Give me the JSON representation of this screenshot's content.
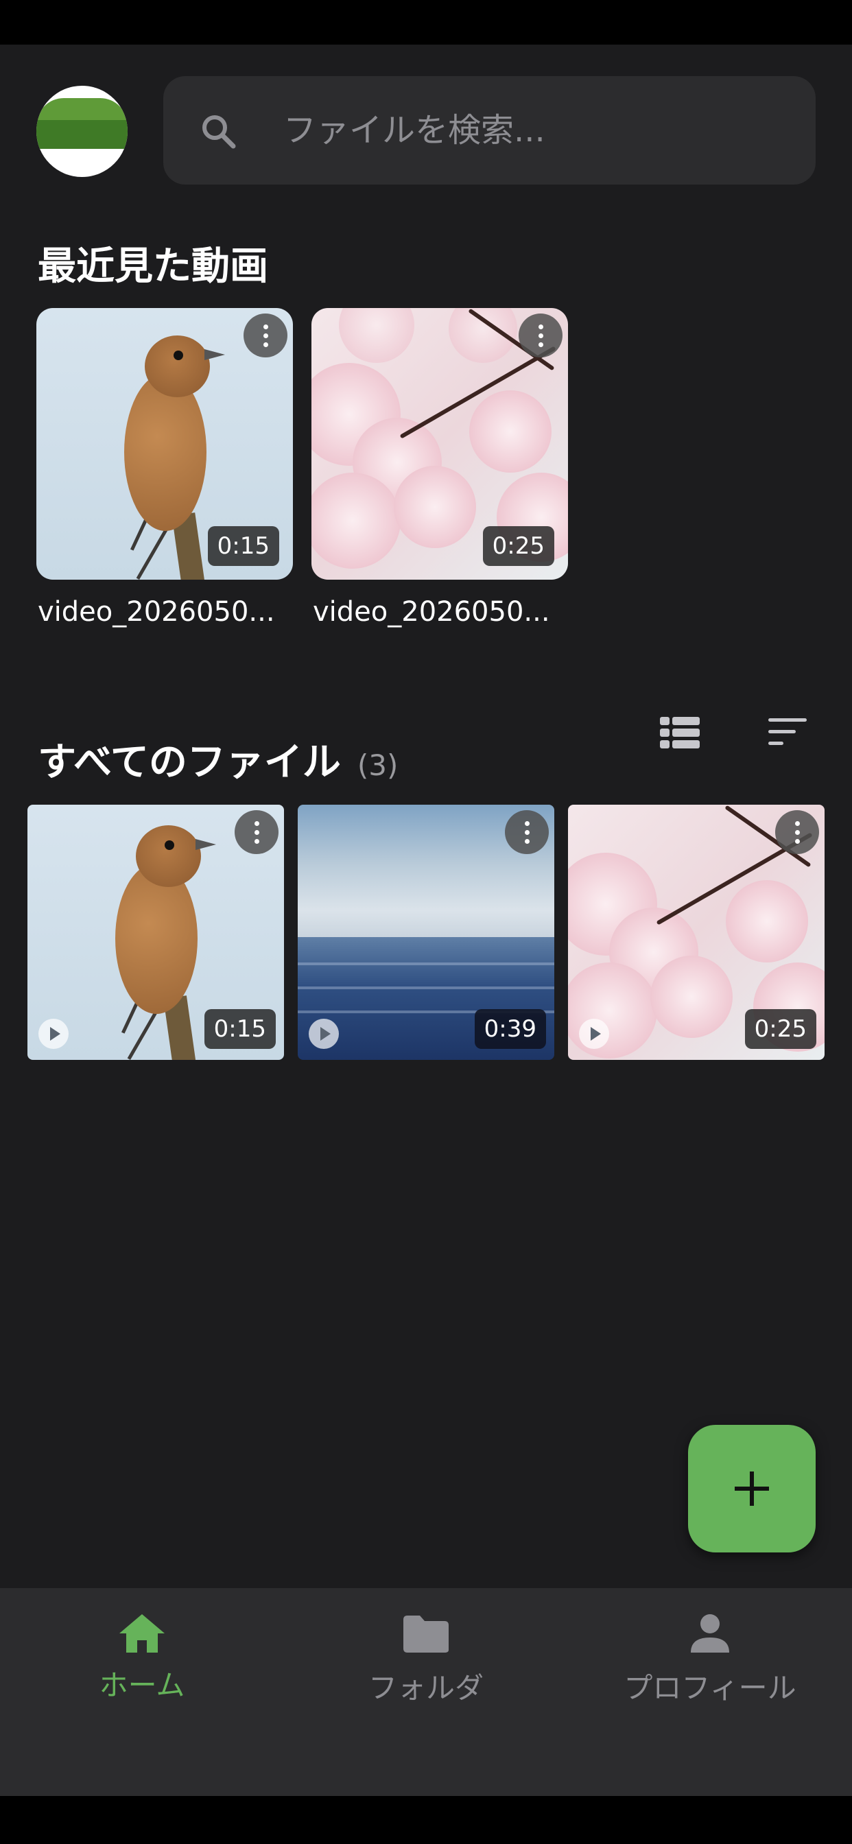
{
  "search": {
    "placeholder": "ファイルを検索..."
  },
  "recent": {
    "title": "最近見た動画",
    "items": [
      {
        "name": "video_2026050...",
        "duration": "0:15",
        "thumbnail": "bird"
      },
      {
        "name": "video_2026050...",
        "duration": "0:25",
        "thumbnail": "cherry-blossom"
      }
    ]
  },
  "all_files": {
    "title": "すべてのファイル",
    "count": "(3)",
    "items": [
      {
        "duration": "0:15",
        "thumbnail": "bird"
      },
      {
        "duration": "0:39",
        "thumbnail": "sea"
      },
      {
        "duration": "0:25",
        "thumbnail": "cherry-blossom"
      }
    ]
  },
  "nav": {
    "items": [
      {
        "label": "ホーム",
        "icon": "home-icon",
        "active": true
      },
      {
        "label": "フォルダ",
        "icon": "folder-icon",
        "active": false
      },
      {
        "label": "プロフィール",
        "icon": "person-icon",
        "active": false
      }
    ]
  },
  "colors": {
    "accent": "#66b35a",
    "background": "#1c1c1e",
    "surface": "#2c2c2e",
    "inactive": "#8e8e93"
  }
}
